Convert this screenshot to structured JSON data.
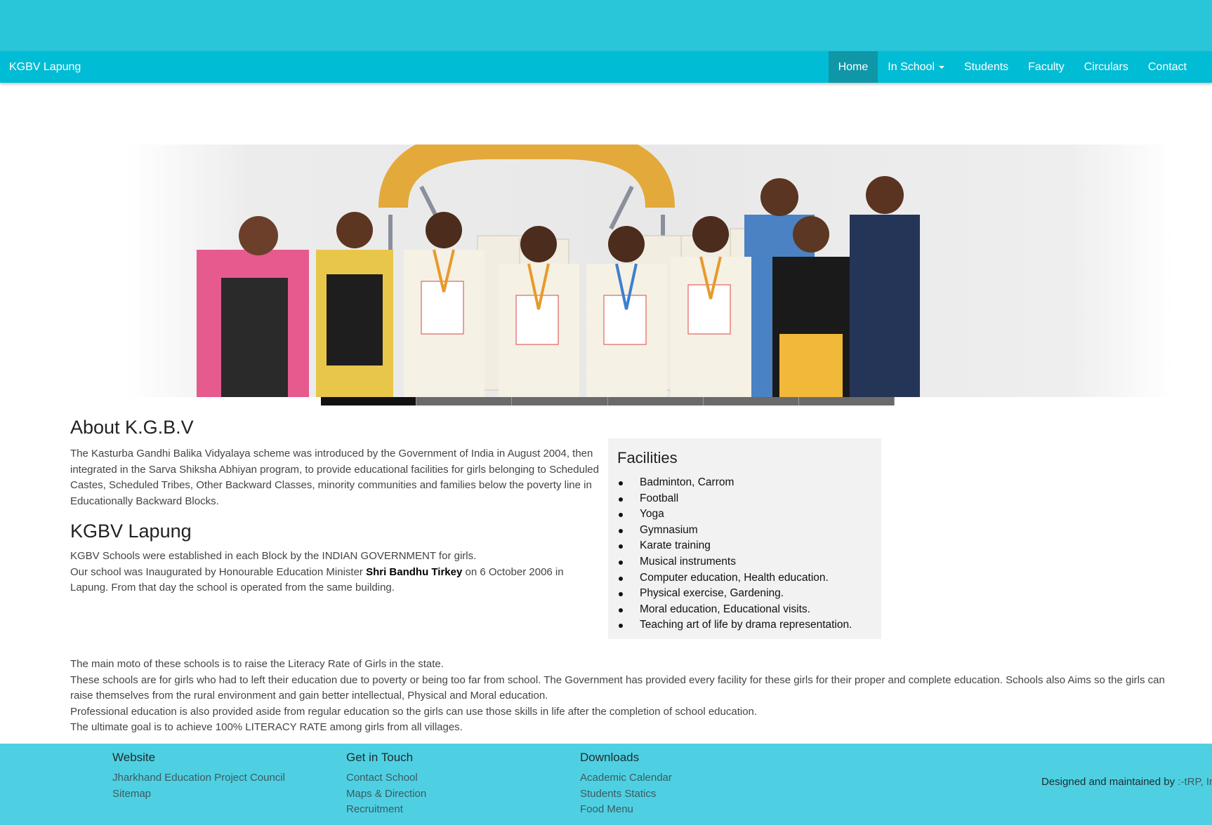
{
  "navbar": {
    "brand": "KGBV Lapung",
    "items": [
      {
        "label": "Home",
        "active": true
      },
      {
        "label": "In School",
        "dropdown": true
      },
      {
        "label": "Students"
      },
      {
        "label": "Faculty"
      },
      {
        "label": "Circulars"
      },
      {
        "label": "Contact"
      }
    ]
  },
  "carousel": {
    "slide_count": 6,
    "active_index": 0
  },
  "about": {
    "title": "About K.G.B.V",
    "text": "The Kasturba Gandhi Balika Vidyalaya scheme was introduced by the Government of India in August 2004, then integrated in the Sarva Shiksha Abhiyan program, to provide educational facilities for girls belonging to Scheduled Castes, Scheduled Tribes, Other Backward Classes, minority communities and families below the poverty line in Educationally Backward Blocks."
  },
  "lapung": {
    "title": "KGBV Lapung",
    "line1": "KGBV Schools were established in each Block by the INDIAN GOVERNMENT for girls.",
    "line2_before": "Our school was Inaugurated by Honourable Education Minister ",
    "line2_bold": "Shri Bandhu Tirkey",
    "line2_after": " on 6 October 2006 in Lapung. From that day the school is operated from the same building."
  },
  "facilities": {
    "title": "Facilities",
    "items": [
      "Badminton, Carrom",
      "Football",
      "Yoga",
      "Gymnasium",
      "Karate training",
      "Musical instruments",
      "Computer education, Health education.",
      "Physical exercise, Gardening.",
      "Moral education, Educational visits.",
      "Teaching art of life by drama representation."
    ]
  },
  "mission": {
    "lines": [
      "The main moto of these schools is to raise the Literacy Rate of Girls in the state.",
      "These schools are for girls who had to left their education due to poverty or being too far from school. The Government has provided every facility for these girls for their proper and complete education. Schools also Aims so the girls can raise themselves from the rural environment and gain better intellectual, Physical and Moral education.",
      "Professional education is also provided aside from regular education so the girls can use those skills in life after the completion of school education.",
      "The ultimate goal is to achieve 100% LITERACY RATE among girls from all villages."
    ]
  },
  "footer": {
    "website": {
      "title": "Website",
      "links": [
        "Jharkhand Education Project Council",
        "Sitemap"
      ]
    },
    "contact": {
      "title": "Get in Touch",
      "links": [
        "Contact School",
        "Maps & Direction",
        "Recruitment"
      ]
    },
    "downloads": {
      "title": "Downloads",
      "links": [
        "Academic Calendar",
        "Students Statics",
        "Food Menu"
      ]
    },
    "credit_prefix": "Designed and maintained by ",
    "credit_link": ":-tRP, India"
  },
  "colors": {
    "topband": "#29c6da",
    "navbar": "#00bcd4",
    "nav_active": "#0f97a8",
    "footer": "#4fd0e2"
  }
}
